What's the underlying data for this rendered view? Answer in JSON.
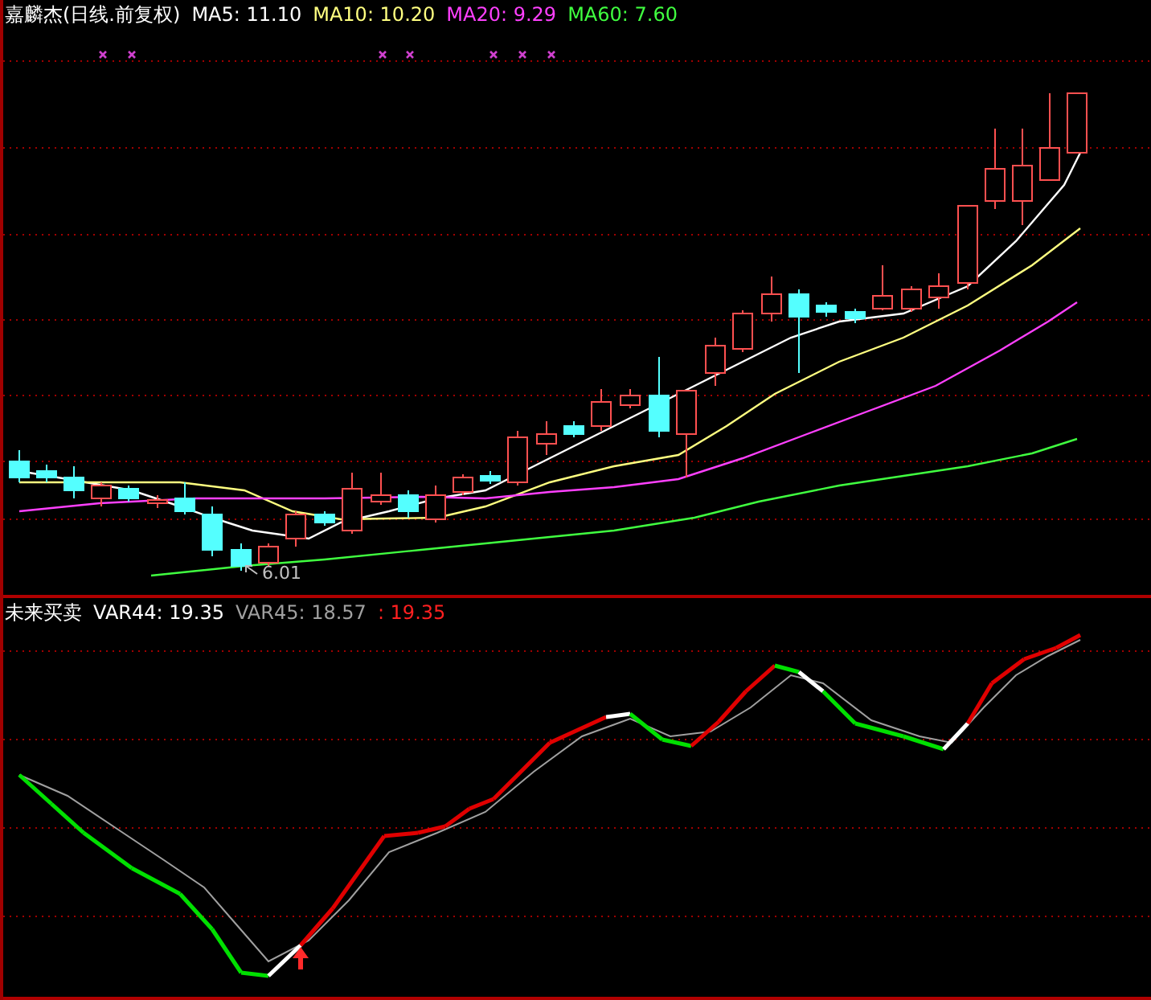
{
  "price_panel": {
    "title": "嘉麟杰(日线.前复权)",
    "moving_averages": [
      {
        "label": "MA5: 11.10",
        "color": "#ffffff"
      },
      {
        "label": "MA10: 10.20",
        "color": "#ffff80"
      },
      {
        "label": "MA20: 9.29",
        "color": "#ff40ff"
      },
      {
        "label": "MA60: 7.60",
        "color": "#40ff40"
      }
    ],
    "low_label": "6.01"
  },
  "indicator_panel": {
    "title": "未来买卖",
    "values": [
      {
        "label": "VAR44: 19.35",
        "color": "#ffffff"
      },
      {
        "label": "VAR45: 18.57",
        "color": "#a0a0a0"
      },
      {
        "label": ": 19.35",
        "color": "#ff2020"
      }
    ]
  }
}
